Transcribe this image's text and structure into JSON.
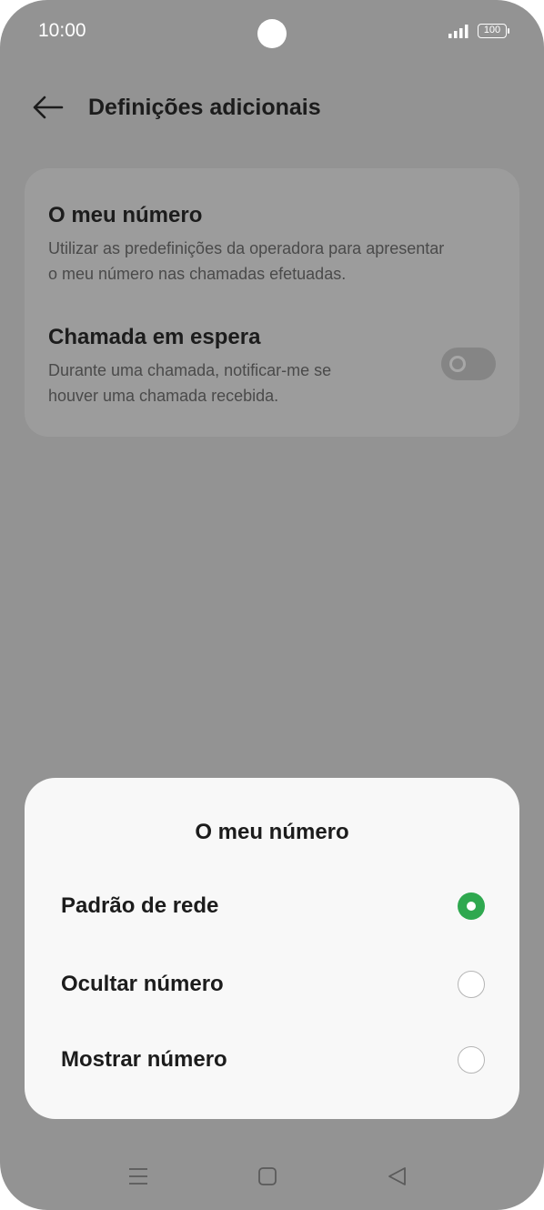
{
  "status_bar": {
    "time": "10:00",
    "battery": "100"
  },
  "header": {
    "title": "Definições adicionais"
  },
  "settings": {
    "my_number": {
      "title": "O meu número",
      "description_line1": "Utilizar as predefinições da operadora para apresentar",
      "description_line2": "o meu número nas chamadas efetuadas."
    },
    "call_waiting": {
      "title": "Chamada em espera",
      "description_line1": "Durante uma chamada, notificar-me se",
      "description_line2": "houver uma chamada recebida.",
      "enabled": false
    }
  },
  "dialog": {
    "title": "O meu número",
    "options": [
      {
        "label": "Padrão de rede",
        "selected": true
      },
      {
        "label": "Ocultar número",
        "selected": false
      },
      {
        "label": "Mostrar número",
        "selected": false
      }
    ],
    "accent_color": "#2fa84f"
  },
  "navigation": {
    "icons": [
      "menu-icon",
      "home-icon",
      "back-triangle-icon"
    ]
  }
}
